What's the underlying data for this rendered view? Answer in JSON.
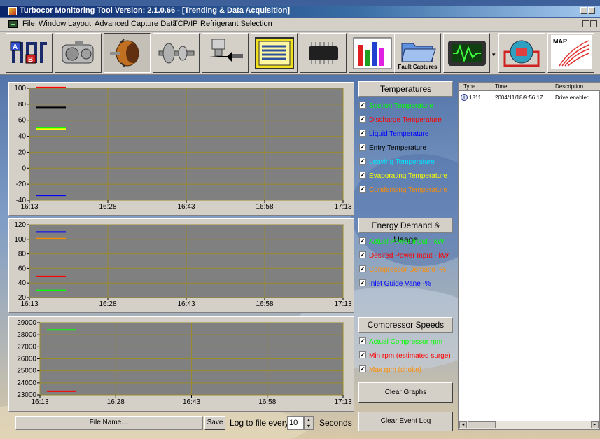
{
  "window": {
    "title": "Turbocor Monitoring Tool Version: 2.1.0.66 - [Trending & Data Acquisition]"
  },
  "menu": [
    "File",
    "Window",
    "Layout",
    "Advanced",
    "Capture Data",
    "TCP/IP",
    "Refrigerant Selection"
  ],
  "toolbar": {
    "buttons": [
      {
        "icon": "system-diagram-icon"
      },
      {
        "icon": "compressor-icon"
      },
      {
        "icon": "motor-rotor-icon",
        "pressed": true
      },
      {
        "icon": "bearing-shaft-icon"
      },
      {
        "icon": "valve-actuator-icon"
      },
      {
        "icon": "data-panel-icon"
      },
      {
        "icon": "chip-icon"
      },
      {
        "icon": "bar-chart-icon"
      },
      {
        "icon": "fault-captures-folder-icon",
        "label": "Fault Captures"
      },
      {
        "icon": "oscilloscope-icon"
      },
      {
        "icon": "refrigeration-circuit-icon"
      },
      {
        "icon": "compressor-map-icon",
        "label": "MAP"
      }
    ]
  },
  "legends": {
    "temperatures": {
      "header": "Temperatures",
      "items": [
        {
          "label": "Suction Temperature",
          "color": "#00ff00"
        },
        {
          "label": "Discharge Temperature",
          "color": "#ff0000"
        },
        {
          "label": "Liquid Temperature",
          "color": "#0000ff"
        },
        {
          "label": "Entry Temperature",
          "color": "#000000"
        },
        {
          "label": "Leaving Temperature",
          "color": "#00e5ff"
        },
        {
          "label": "Evaporating Temperature",
          "color": "#ffff00"
        },
        {
          "label": "Condensing Temperature",
          "color": "#ff8c00"
        }
      ]
    },
    "energy": {
      "header": "Energy Demand & Usage",
      "items": [
        {
          "label": "Actual Power Input - kW",
          "color": "#00ff00"
        },
        {
          "label": "Desired Power Input - kW",
          "color": "#ff0000"
        },
        {
          "label": "Compressor Demand -%",
          "color": "#ff8c00"
        },
        {
          "label": "Inlet Guide Vane -%",
          "color": "#0000ff"
        }
      ]
    },
    "speeds": {
      "header": "Compressor Speeds",
      "items": [
        {
          "label": "Actual Compressor rpm",
          "color": "#00ff00"
        },
        {
          "label": "Min rpm (estimated surge)",
          "color": "#ff0000"
        },
        {
          "label": "Max rpm (choke)",
          "color": "#ff8c00"
        }
      ]
    }
  },
  "buttons": {
    "clear_graphs": "Clear Graphs",
    "clear_event_log": "Clear Event Log",
    "save": "Save",
    "file_name": "File Name....",
    "log_prefix": "Log to file every",
    "log_interval": "10",
    "log_unit": "Seconds"
  },
  "event_log": {
    "columns": [
      "Type",
      "Time",
      "Description"
    ],
    "rows": [
      {
        "type": "1811",
        "time": "2004/11/18/9:56:17",
        "description": "Drive enabled."
      }
    ]
  },
  "chart_data": [
    {
      "type": "line",
      "x_ticks": [
        "16:13",
        "16:28",
        "16:43",
        "16:58",
        "17:13"
      ],
      "y_ticks": [
        "100",
        "80",
        "60",
        "40",
        "20",
        "0",
        "-20",
        "-40"
      ],
      "ylim": [
        -40,
        100
      ],
      "grid": true,
      "background": "#808080",
      "series": [
        {
          "color": "#ff0000",
          "values": [
            101
          ]
        },
        {
          "color": "#000000",
          "values": [
            76
          ]
        },
        {
          "color": "#00ff00",
          "values": [
            50
          ]
        },
        {
          "color": "#ffff00",
          "values": [
            49
          ]
        },
        {
          "color": "#0000ff",
          "values": [
            -34
          ]
        }
      ]
    },
    {
      "type": "line",
      "x_ticks": [
        "16:13",
        "16:28",
        "16:43",
        "16:58",
        "17:13"
      ],
      "y_ticks": [
        "120",
        "100",
        "80",
        "60",
        "40",
        "20"
      ],
      "ylim": [
        20,
        120
      ],
      "grid": true,
      "background": "#808080",
      "series": [
        {
          "color": "#0000ff",
          "values": [
            110
          ]
        },
        {
          "color": "#ff8c00",
          "values": [
            101
          ]
        },
        {
          "color": "#ff0000",
          "values": [
            49
          ]
        },
        {
          "color": "#00ff00",
          "values": [
            30
          ]
        }
      ]
    },
    {
      "type": "line",
      "x_ticks": [
        "16:13",
        "16:28",
        "16:43",
        "16:58",
        "17:13"
      ],
      "y_ticks": [
        "29000",
        "28000",
        "27000",
        "26000",
        "25000",
        "24000",
        "23000"
      ],
      "ylim": [
        23000,
        29000
      ],
      "grid": true,
      "background": "#808080",
      "series": [
        {
          "color": "#00ff00",
          "values": [
            28400
          ]
        },
        {
          "color": "#ff0000",
          "values": [
            23300
          ]
        }
      ]
    }
  ]
}
